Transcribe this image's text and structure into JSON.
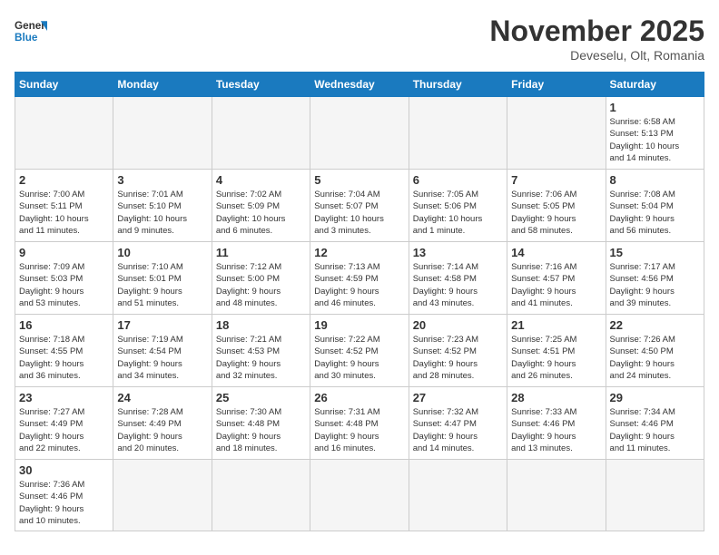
{
  "logo": {
    "general": "General",
    "blue": "Blue"
  },
  "title": "November 2025",
  "subtitle": "Deveselu, Olt, Romania",
  "days_header": [
    "Sunday",
    "Monday",
    "Tuesday",
    "Wednesday",
    "Thursday",
    "Friday",
    "Saturday"
  ],
  "weeks": [
    [
      {
        "day": "",
        "info": "",
        "empty": true
      },
      {
        "day": "",
        "info": "",
        "empty": true
      },
      {
        "day": "",
        "info": "",
        "empty": true
      },
      {
        "day": "",
        "info": "",
        "empty": true
      },
      {
        "day": "",
        "info": "",
        "empty": true
      },
      {
        "day": "",
        "info": "",
        "empty": true
      },
      {
        "day": "1",
        "info": "Sunrise: 6:58 AM\nSunset: 5:13 PM\nDaylight: 10 hours\nand 14 minutes."
      }
    ],
    [
      {
        "day": "2",
        "info": "Sunrise: 7:00 AM\nSunset: 5:11 PM\nDaylight: 10 hours\nand 11 minutes."
      },
      {
        "day": "3",
        "info": "Sunrise: 7:01 AM\nSunset: 5:10 PM\nDaylight: 10 hours\nand 9 minutes."
      },
      {
        "day": "4",
        "info": "Sunrise: 7:02 AM\nSunset: 5:09 PM\nDaylight: 10 hours\nand 6 minutes."
      },
      {
        "day": "5",
        "info": "Sunrise: 7:04 AM\nSunset: 5:07 PM\nDaylight: 10 hours\nand 3 minutes."
      },
      {
        "day": "6",
        "info": "Sunrise: 7:05 AM\nSunset: 5:06 PM\nDaylight: 10 hours\nand 1 minute."
      },
      {
        "day": "7",
        "info": "Sunrise: 7:06 AM\nSunset: 5:05 PM\nDaylight: 9 hours\nand 58 minutes."
      },
      {
        "day": "8",
        "info": "Sunrise: 7:08 AM\nSunset: 5:04 PM\nDaylight: 9 hours\nand 56 minutes."
      }
    ],
    [
      {
        "day": "9",
        "info": "Sunrise: 7:09 AM\nSunset: 5:03 PM\nDaylight: 9 hours\nand 53 minutes."
      },
      {
        "day": "10",
        "info": "Sunrise: 7:10 AM\nSunset: 5:01 PM\nDaylight: 9 hours\nand 51 minutes."
      },
      {
        "day": "11",
        "info": "Sunrise: 7:12 AM\nSunset: 5:00 PM\nDaylight: 9 hours\nand 48 minutes."
      },
      {
        "day": "12",
        "info": "Sunrise: 7:13 AM\nSunset: 4:59 PM\nDaylight: 9 hours\nand 46 minutes."
      },
      {
        "day": "13",
        "info": "Sunrise: 7:14 AM\nSunset: 4:58 PM\nDaylight: 9 hours\nand 43 minutes."
      },
      {
        "day": "14",
        "info": "Sunrise: 7:16 AM\nSunset: 4:57 PM\nDaylight: 9 hours\nand 41 minutes."
      },
      {
        "day": "15",
        "info": "Sunrise: 7:17 AM\nSunset: 4:56 PM\nDaylight: 9 hours\nand 39 minutes."
      }
    ],
    [
      {
        "day": "16",
        "info": "Sunrise: 7:18 AM\nSunset: 4:55 PM\nDaylight: 9 hours\nand 36 minutes."
      },
      {
        "day": "17",
        "info": "Sunrise: 7:19 AM\nSunset: 4:54 PM\nDaylight: 9 hours\nand 34 minutes."
      },
      {
        "day": "18",
        "info": "Sunrise: 7:21 AM\nSunset: 4:53 PM\nDaylight: 9 hours\nand 32 minutes."
      },
      {
        "day": "19",
        "info": "Sunrise: 7:22 AM\nSunset: 4:52 PM\nDaylight: 9 hours\nand 30 minutes."
      },
      {
        "day": "20",
        "info": "Sunrise: 7:23 AM\nSunset: 4:52 PM\nDaylight: 9 hours\nand 28 minutes."
      },
      {
        "day": "21",
        "info": "Sunrise: 7:25 AM\nSunset: 4:51 PM\nDaylight: 9 hours\nand 26 minutes."
      },
      {
        "day": "22",
        "info": "Sunrise: 7:26 AM\nSunset: 4:50 PM\nDaylight: 9 hours\nand 24 minutes."
      }
    ],
    [
      {
        "day": "23",
        "info": "Sunrise: 7:27 AM\nSunset: 4:49 PM\nDaylight: 9 hours\nand 22 minutes."
      },
      {
        "day": "24",
        "info": "Sunrise: 7:28 AM\nSunset: 4:49 PM\nDaylight: 9 hours\nand 20 minutes."
      },
      {
        "day": "25",
        "info": "Sunrise: 7:30 AM\nSunset: 4:48 PM\nDaylight: 9 hours\nand 18 minutes."
      },
      {
        "day": "26",
        "info": "Sunrise: 7:31 AM\nSunset: 4:48 PM\nDaylight: 9 hours\nand 16 minutes."
      },
      {
        "day": "27",
        "info": "Sunrise: 7:32 AM\nSunset: 4:47 PM\nDaylight: 9 hours\nand 14 minutes."
      },
      {
        "day": "28",
        "info": "Sunrise: 7:33 AM\nSunset: 4:46 PM\nDaylight: 9 hours\nand 13 minutes."
      },
      {
        "day": "29",
        "info": "Sunrise: 7:34 AM\nSunset: 4:46 PM\nDaylight: 9 hours\nand 11 minutes."
      }
    ],
    [
      {
        "day": "30",
        "info": "Sunrise: 7:36 AM\nSunset: 4:46 PM\nDaylight: 9 hours\nand 10 minutes."
      },
      {
        "day": "",
        "info": "",
        "empty": true
      },
      {
        "day": "",
        "info": "",
        "empty": true
      },
      {
        "day": "",
        "info": "",
        "empty": true
      },
      {
        "day": "",
        "info": "",
        "empty": true
      },
      {
        "day": "",
        "info": "",
        "empty": true
      },
      {
        "day": "",
        "info": "",
        "empty": true
      }
    ]
  ]
}
